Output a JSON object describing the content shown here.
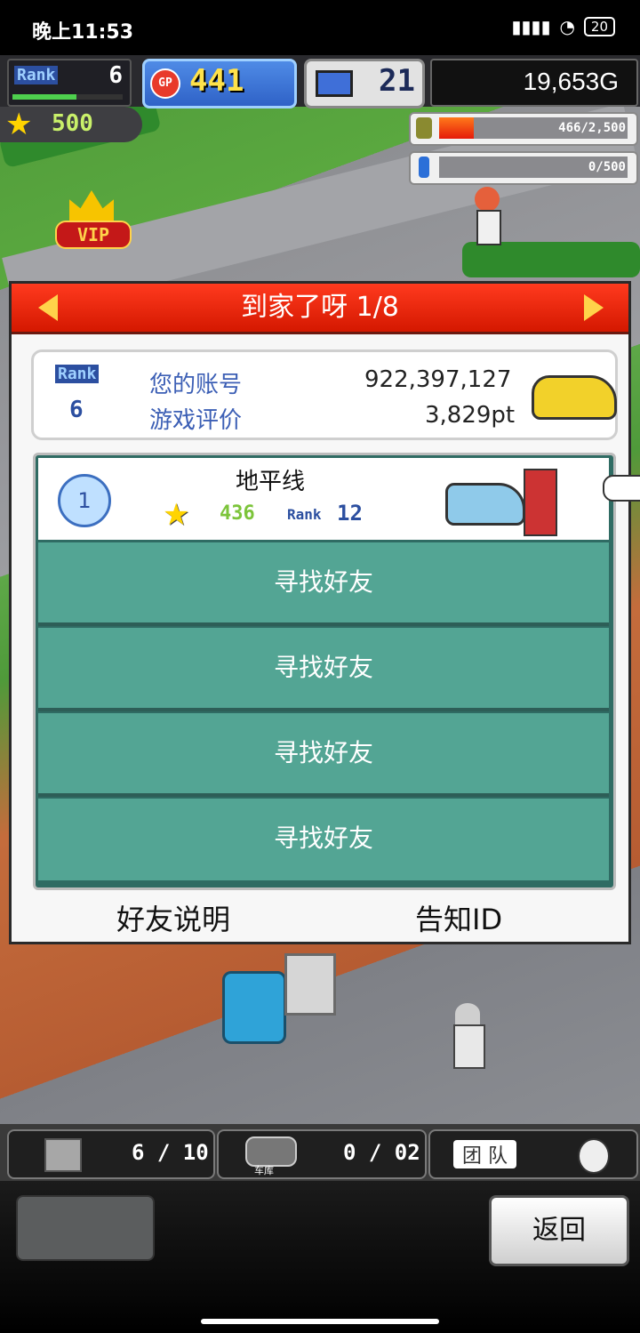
{
  "status_bar": {
    "time": "晚上11:53",
    "battery": "20"
  },
  "hud": {
    "rank_label": "Rank",
    "rank_value": "6",
    "gp_label": "GP",
    "gp_value": "441",
    "pc_value": "21",
    "gold": "19,653G",
    "stars": "500",
    "gauge1": "466/2,500",
    "gauge1_fill": 0.186,
    "gauge2": "0/500",
    "gauge2_fill": 0,
    "vip": "VIP"
  },
  "dialog": {
    "title": "到家了呀 1/8",
    "profile": {
      "rank_label": "Rank",
      "rank_value": "6",
      "account_label": "您的账号",
      "account_value": "922,397,127",
      "rating_label": "游戏评价",
      "rating_value": "3,829pt"
    },
    "friend": {
      "number": "1",
      "name": "地平线",
      "stars": "436",
      "rank_label": "Rank",
      "rank_value": "12"
    },
    "find_friend_slots": [
      "寻找好友",
      "寻找好友",
      "寻找好友",
      "寻找好友"
    ],
    "friend_help": "好友说明",
    "notify_id": "告知ID"
  },
  "bottom_hud": {
    "count1": "6 / 10",
    "garage_label": "车库",
    "count2": "0 / 02",
    "team_label": "团 队",
    "back_button": "返回"
  },
  "colors": {
    "title_red": "#e42a0c",
    "slot_teal": "#53a594",
    "accent_blue": "#3c5fb5"
  }
}
